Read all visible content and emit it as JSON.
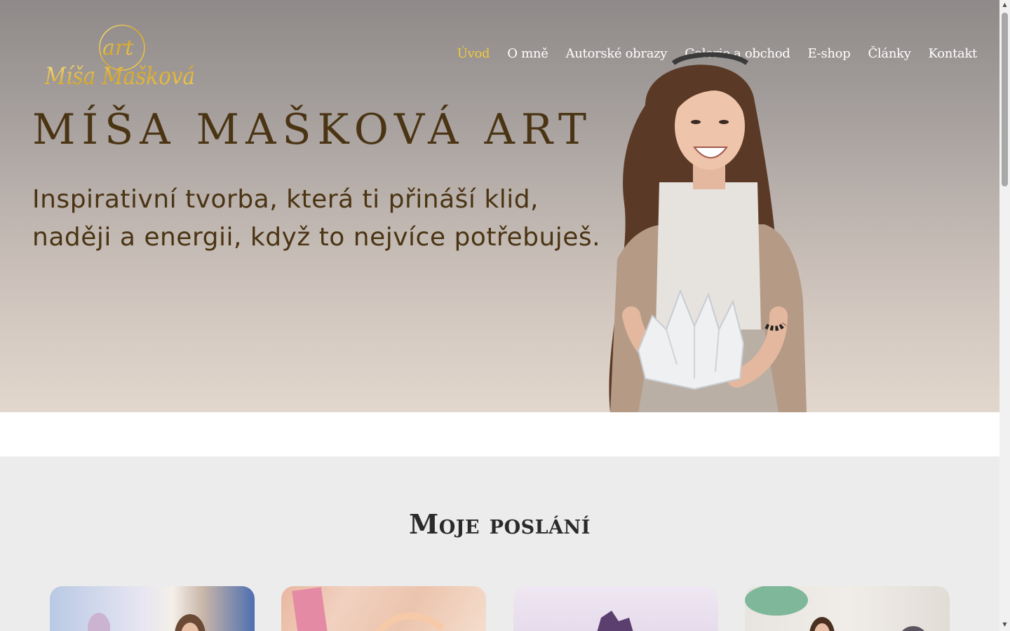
{
  "logo": {
    "script_top": "art",
    "script_bottom": "Míša Mašková"
  },
  "nav": {
    "items": [
      {
        "label": "Úvod",
        "active": true
      },
      {
        "label": "O mně",
        "active": false
      },
      {
        "label": "Autorské obrazy",
        "active": false
      },
      {
        "label": "Galerie a obchod",
        "active": false
      },
      {
        "label": "E-shop",
        "active": false
      },
      {
        "label": "Články",
        "active": false
      },
      {
        "label": "Kontakt",
        "active": false
      }
    ]
  },
  "hero": {
    "title": "MÍŠA MAŠKOVÁ ART",
    "subtitle_line1": "Inspirativní tvorba, která ti přináší klid,",
    "subtitle_line2": "naději a energii, když to nejvíce potřebuješ."
  },
  "mission": {
    "title": "Moje poslání"
  },
  "colors": {
    "accent_gold": "#f3c83a",
    "hero_text": "#4a3413",
    "nav_text": "#ffffff",
    "section_bg": "#ececec"
  },
  "icons": {
    "scroll_up": "▲",
    "scroll_down": "▼"
  }
}
